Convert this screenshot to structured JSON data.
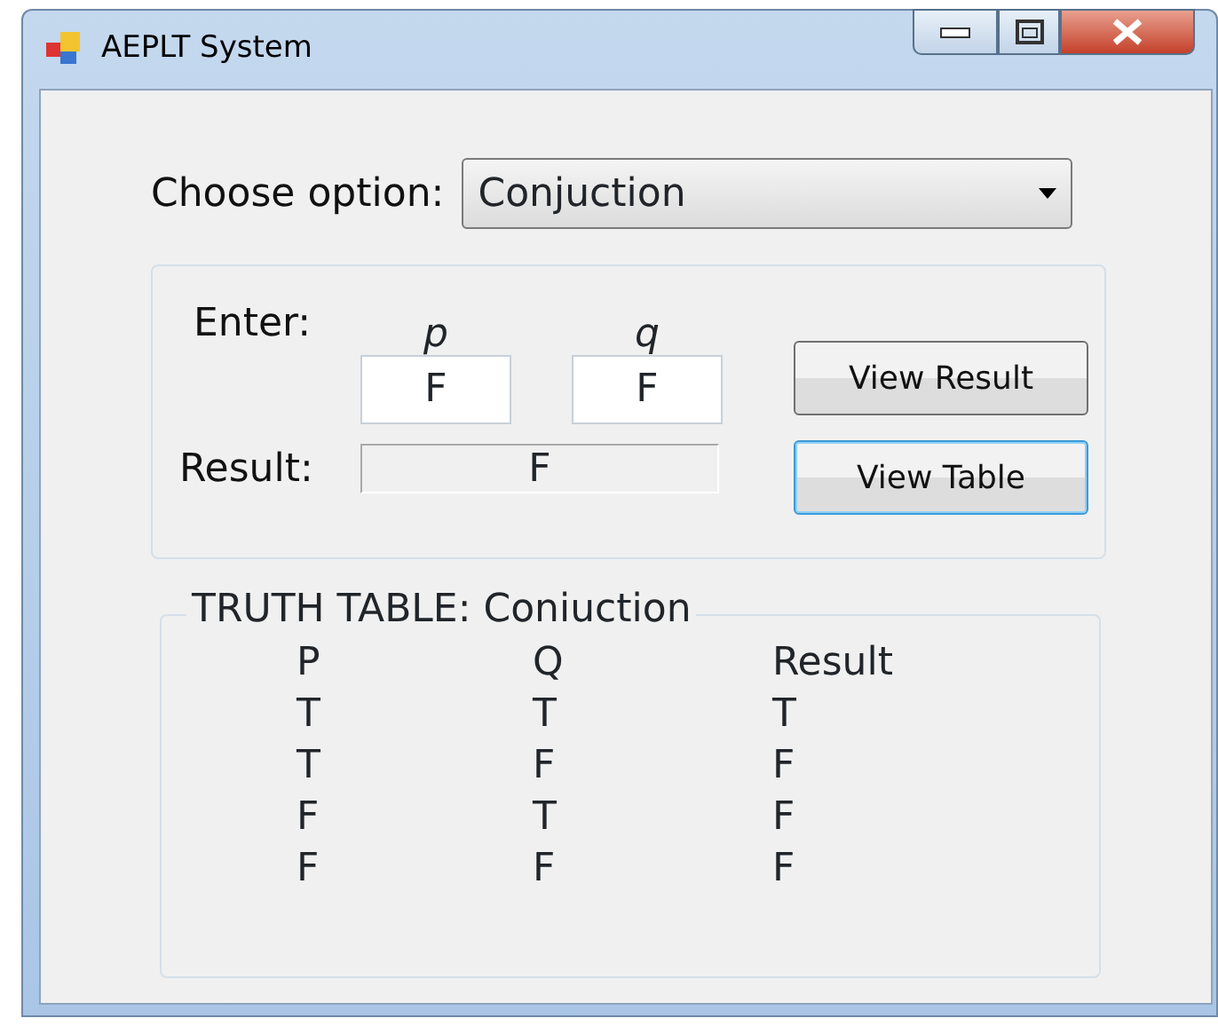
{
  "window": {
    "title": "AEPLT System"
  },
  "option": {
    "label": "Choose option:",
    "value": "Conjuction"
  },
  "input_group": {
    "enter_label": "Enter:",
    "p_label": "p",
    "q_label": "q",
    "p_value": "F",
    "q_value": "F",
    "result_label": "Result:",
    "result_value": "F"
  },
  "buttons": [
    {
      "label": "View Result",
      "focused": false
    },
    {
      "label": "View Table",
      "focused": true
    }
  ],
  "truth_table": {
    "title": "TRUTH TABLE: Coniuction",
    "columns": [
      "P",
      "Q",
      "Result"
    ],
    "rows": [
      [
        "T",
        "T",
        "T"
      ],
      [
        "T",
        "F",
        "F"
      ],
      [
        "F",
        "T",
        "F"
      ],
      [
        "F",
        "F",
        "F"
      ]
    ]
  }
}
